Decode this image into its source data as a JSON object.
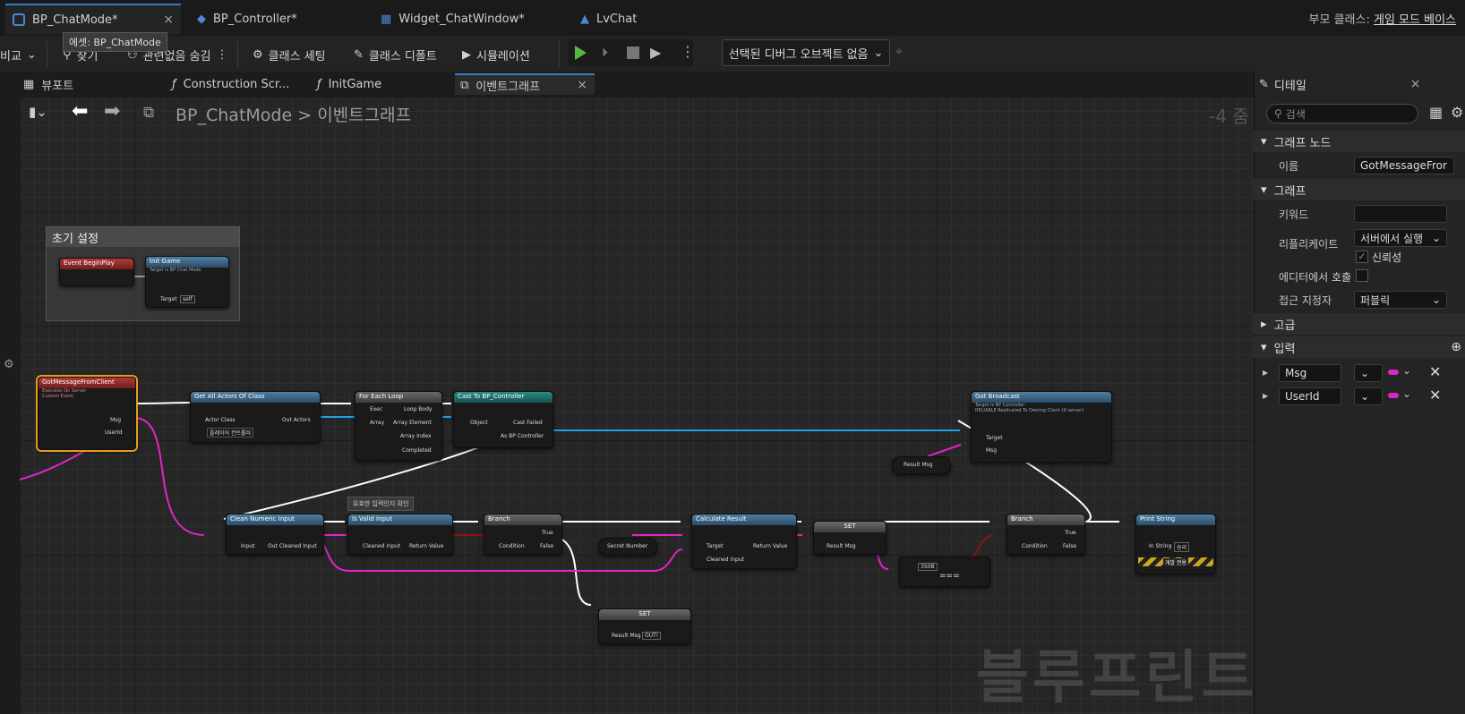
{
  "tabs": [
    {
      "label": "BP_ChatMode*",
      "close": "×"
    },
    {
      "label": "BP_Controller*"
    },
    {
      "label": "Widget_ChatWindow*"
    },
    {
      "label": "LvChat"
    }
  ],
  "parent_class": {
    "label": "부모 클래스:",
    "value": "게임 모드 베이스"
  },
  "tooltip": "에셋: BP_ChatMode",
  "toolbar": {
    "compare": "비교",
    "find": "찾기",
    "hide_unrelated": "관련없음 숨김",
    "class_settings": "클래스 세팅",
    "class_defaults": "클래스 디폴트",
    "simulation": "시뮬레이션",
    "debug_object": "선택된 디버그 오브젝트 없음"
  },
  "doc_tabs": [
    {
      "label": "뷰포트"
    },
    {
      "label": "Construction Scr..."
    },
    {
      "label": "InitGame"
    },
    {
      "label": "이벤트그래프",
      "close": "×"
    }
  ],
  "breadcrumb": {
    "root": "BP_ChatMode",
    "sep": ">",
    "current": "이벤트그래프"
  },
  "zoom": "-4 줌",
  "watermark": "블루프린트",
  "comment": "초기 설정",
  "nodes": {
    "begin_play": "Event BeginPlay",
    "init_game": {
      "title": "Init Game",
      "sub": "Target is BP Chat Mode",
      "target": "Target",
      "self": "self"
    },
    "got_msg": {
      "title": "GotMessageFromClient",
      "sub1": "Executes On Server",
      "sub2": "Custom Event",
      "msg": "Msg",
      "userid": "UserId"
    },
    "get_all": {
      "title": "Get All Actors Of Class",
      "actor_class": "Actor Class",
      "class_val": "플레이어 컨트롤러",
      "out": "Out Actors"
    },
    "for_each": {
      "title": "For Each Loop",
      "exec": "Exec",
      "loop_body": "Loop Body",
      "array": "Array",
      "elem": "Array Element",
      "index": "Array Index",
      "completed": "Completed"
    },
    "cast": {
      "title": "Cast To BP_Controller",
      "object": "Object",
      "failed": "Cast Failed",
      "as": "As BP Controller"
    },
    "broadcast": {
      "title": "Got Broadcast",
      "sub1": "Target is BP Controller",
      "sub2": "RELIABLE Replicated To Owning Client (if server)",
      "target": "Target",
      "msg": "Msg"
    },
    "result_msg": "Result Msg",
    "clean": {
      "title": "Clean Numeric Input",
      "input": "Input",
      "out": "Out Cleaned Input"
    },
    "note": "유효한 입력인지 확인",
    "valid": {
      "title": "Is Valid Input",
      "in": "Cleaned Input",
      "ret": "Return Value"
    },
    "branch1": {
      "title": "Branch",
      "cond": "Condition",
      "true": "True",
      "false": "False"
    },
    "secret": "Secret Number",
    "calc": {
      "title": "Calculate Result",
      "target": "Target",
      "cleaned": "Cleaned Input",
      "ret": "Return Value"
    },
    "set1": {
      "title": "SET",
      "pin": "Result Msg"
    },
    "equal": {
      "val": "3S0B",
      "op": "==="
    },
    "branch2": {
      "title": "Branch",
      "cond": "Condition",
      "true": "True",
      "false": "False"
    },
    "print": {
      "title": "Print String",
      "in": "In String",
      "val": "승리",
      "dev": "개발 전용"
    },
    "set2": {
      "title": "SET",
      "pin": "Result Msg",
      "val": "OUT!"
    }
  },
  "details": {
    "title": "디테일",
    "search_placeholder": "검색",
    "graph_node_section": "그래프 노드",
    "name_label": "이름",
    "name_value": "GotMessageFror",
    "graph_section": "그래프",
    "keywords_label": "키워드",
    "replicates_label": "리플리케이트",
    "replicates_value": "서버에서 실행",
    "reliable_label": "신뢰성",
    "call_in_editor_label": "에디터에서 호출",
    "access_label": "접근 지정자",
    "access_value": "퍼블릭",
    "advanced_section": "고급",
    "inputs_section": "입력",
    "inputs": [
      {
        "name": "Msg"
      },
      {
        "name": "UserId"
      }
    ]
  },
  "colors": {
    "accent": "#3a78c9",
    "exec": "#ffffff",
    "string": "#e025c8",
    "object": "#1ea0e6",
    "bool": "#8c1414"
  }
}
